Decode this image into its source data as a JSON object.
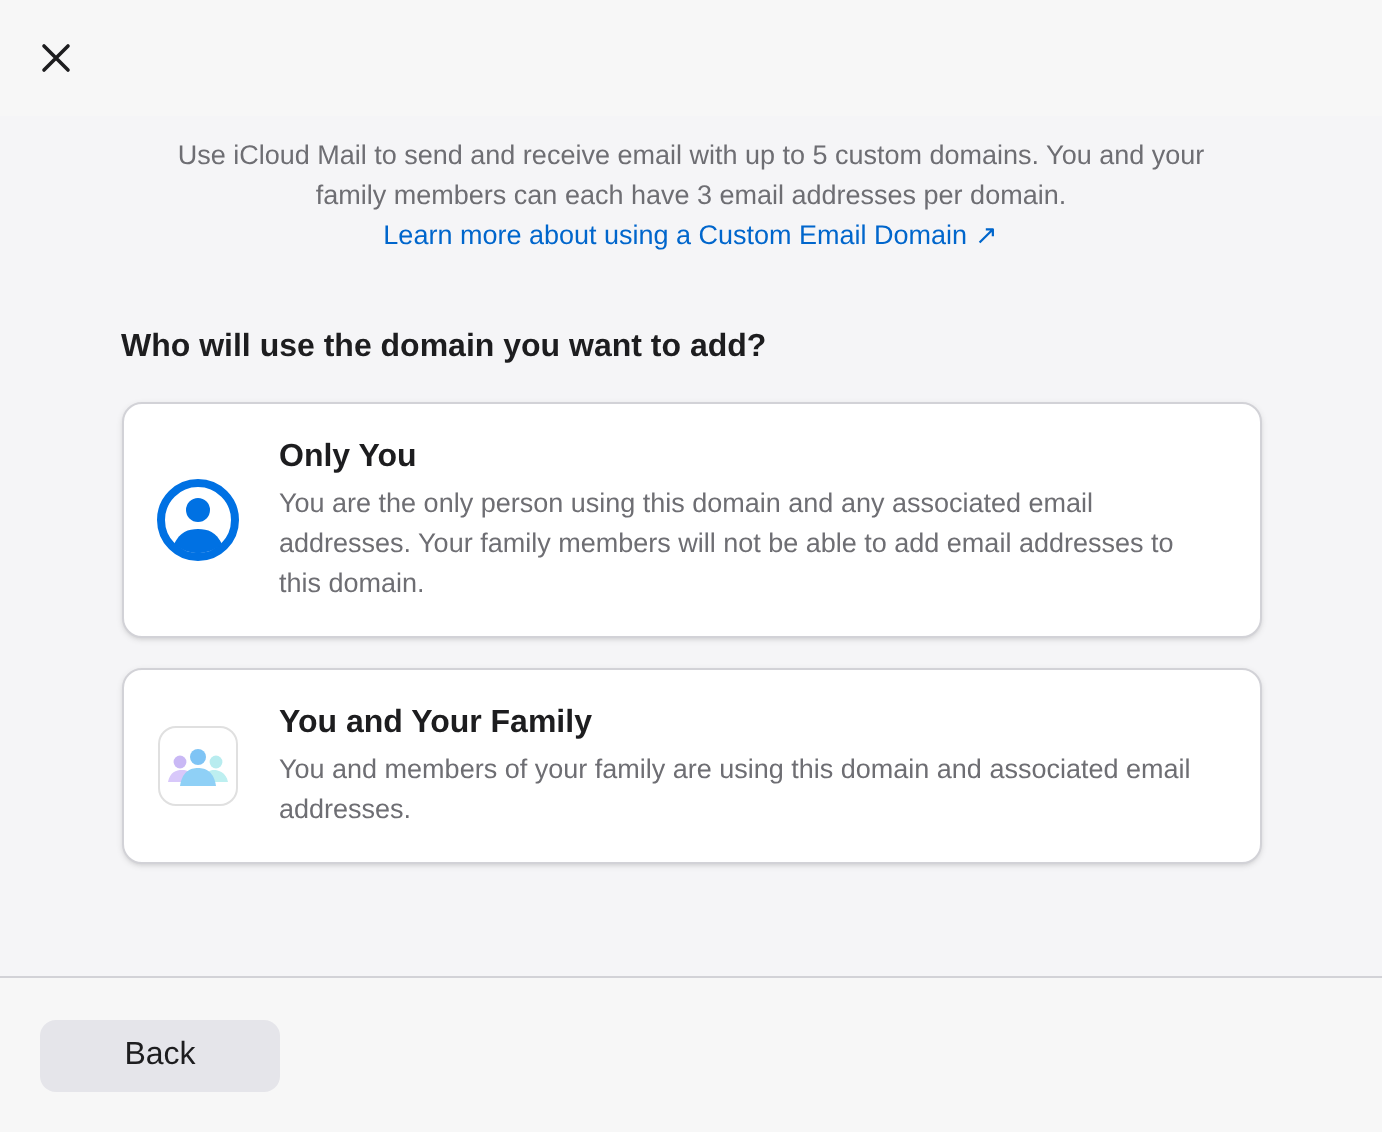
{
  "intro": {
    "text": "Use iCloud Mail to send and receive email with up to 5 custom domains. You and your family members can each have 3 email addresses per domain.",
    "link": "Learn more about using a Custom Email Domain ↗"
  },
  "question": "Who will use the domain you want to add?",
  "options": [
    {
      "kind": "person",
      "title": "Only You",
      "description": "You are the only person using this domain and any associated email addresses. Your family members will not be able to add email addresses to this domain."
    },
    {
      "kind": "family",
      "title": "You and Your Family",
      "description": "You and members of your family are using this domain and associated email addresses."
    }
  ],
  "footer": {
    "button": "Back"
  }
}
